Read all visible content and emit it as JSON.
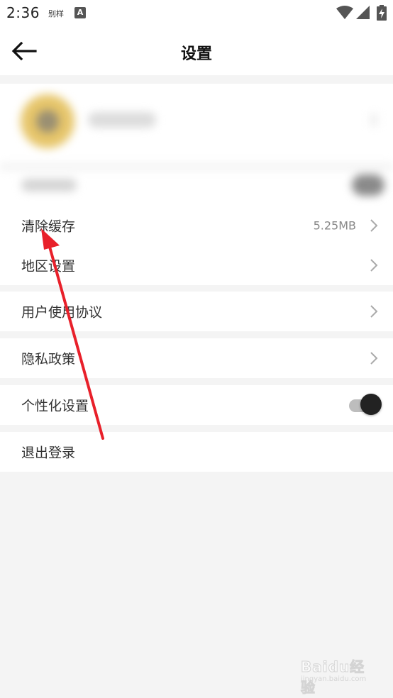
{
  "status_bar": {
    "time": "2:36",
    "carrier": "别样",
    "a_icon_letter": "A",
    "icons": [
      "wifi-icon",
      "signal-icon",
      "battery-charging-icon"
    ]
  },
  "header": {
    "back_icon": "arrow-left-icon",
    "title": "设置"
  },
  "settings": {
    "clear_cache": {
      "label": "清除缓存",
      "value": "5.25MB"
    },
    "region": {
      "label": "地区设置"
    },
    "user_agreement": {
      "label": "用户使用协议"
    },
    "privacy_policy": {
      "label": "隐私政策"
    },
    "personalization": {
      "label": "个性化设置",
      "enabled": true
    },
    "logout": {
      "label": "退出登录"
    }
  },
  "colors": {
    "background": "#f4f4f4",
    "row": "#ffffff",
    "annotation_arrow": "#e8202a",
    "toggle_knob": "#222222"
  },
  "watermark": {
    "text": "Baidu经验",
    "sub": "jingyan.baidu.com"
  }
}
